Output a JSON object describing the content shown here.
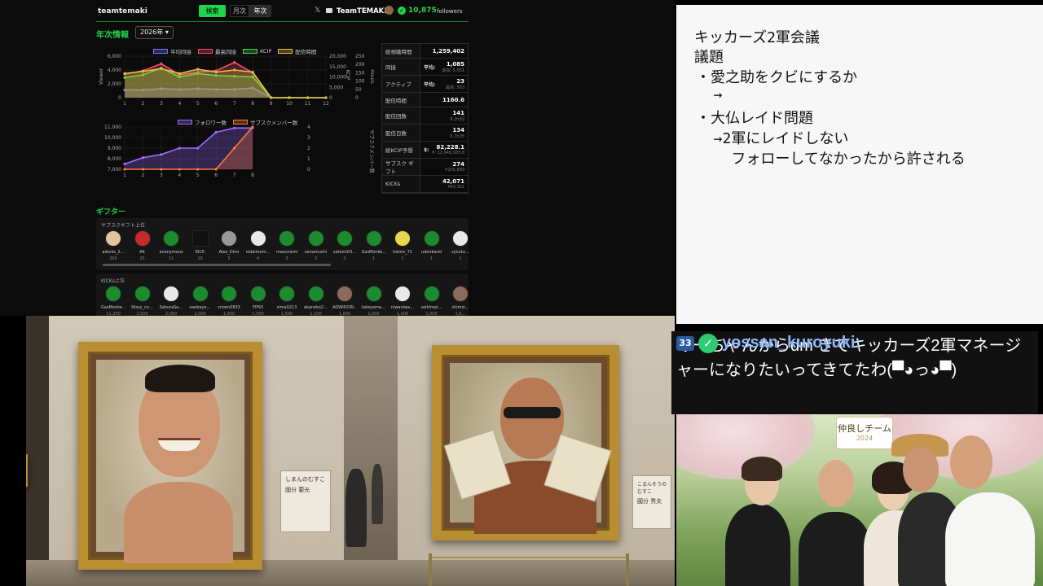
{
  "dashboard": {
    "brand": "teamtemaki",
    "search_label": "検索",
    "toggle_month": "月次",
    "toggle_year": "年次",
    "x_icon": "𝕏",
    "channel_name": "TeamTEMAKI",
    "followers_count": "10,875",
    "followers_label": "followers",
    "annual_title": "年次情報",
    "year_select": "2026年",
    "gifter_title": "ギフター",
    "sub_gift_title": "サブスクギフト上位",
    "kicks_title": "KICKs上位",
    "accent_color": "#1ed44a"
  },
  "chart_data": [
    {
      "type": "line",
      "x": [
        1,
        2,
        3,
        4,
        5,
        6,
        7,
        8,
        9,
        10,
        11,
        12
      ],
      "ylabel": "Viewer",
      "ylim": [
        0,
        6000
      ],
      "y_ticks": [
        "0",
        "2,000",
        "4,000",
        "6,000"
      ],
      "right_axis_1_ticks": [
        "0",
        "5,000",
        "10,000",
        "15,000",
        "20,000"
      ],
      "right_axis_1_label": "KCIP",
      "right_axis_2_ticks": [
        "0",
        "50",
        "100",
        "150",
        "200",
        "250"
      ],
      "right_axis_2_label": "Hours",
      "series": [
        {
          "name": "平均同接",
          "color": "#6a7bff",
          "values": [
            1100,
            1100,
            1300,
            1200,
            1300,
            1200,
            1200,
            1400,
            0,
            0,
            0,
            0
          ]
        },
        {
          "name": "最高同接",
          "color": "#ff4d6a",
          "values": [
            3400,
            3900,
            4900,
            3300,
            3700,
            3900,
            5100,
            3600,
            0,
            0,
            0,
            0
          ]
        },
        {
          "name": "KCIP",
          "color": "#4cd44a",
          "values": [
            2900,
            3300,
            4300,
            3000,
            3500,
            3200,
            3100,
            3000,
            0,
            0,
            0,
            0
          ]
        },
        {
          "name": "配信時間",
          "color": "#e0c040",
          "values": [
            3500,
            3800,
            4200,
            3500,
            4100,
            3700,
            4000,
            3700,
            0,
            0,
            0,
            0
          ]
        }
      ]
    },
    {
      "type": "line",
      "x": [
        1,
        2,
        3,
        4,
        5,
        6,
        7,
        8
      ],
      "ylim": [
        7000,
        11000
      ],
      "y_ticks": [
        "7,000",
        "8,000",
        "9,000",
        "10,000",
        "11,000"
      ],
      "right_ticks": [
        "0",
        "1",
        "2",
        "3",
        "4"
      ],
      "right_label": "サブスクメンバー数",
      "series": [
        {
          "name": "フォロワー数",
          "color": "#9d6cff",
          "values": [
            7500,
            8100,
            8400,
            9000,
            9000,
            10500,
            10900,
            10900
          ]
        },
        {
          "name": "サブスクメンバー数",
          "color": "#ff7a3a",
          "values": [
            0,
            0,
            0,
            0,
            0,
            0,
            2,
            4
          ]
        }
      ]
    }
  ],
  "stats": [
    {
      "key": "総視聴時間",
      "value": "1,259,402"
    },
    {
      "key": "同接",
      "left": "平均:",
      "value": "1,085",
      "sub": "最高: 5,051"
    },
    {
      "key": "アクティブ",
      "left": "平均:",
      "value": "23",
      "sub": "最高: 583"
    },
    {
      "key": "配信時間",
      "value": "1160.6"
    },
    {
      "key": "配信回数",
      "value": "141",
      "sub": "8.2h/回"
    },
    {
      "key": "配信日数",
      "value": "134",
      "sub": "8.7h/日"
    },
    {
      "key": "総KCIP予想",
      "left": "$:",
      "value": "82,228.1",
      "sub": "¥: 12,948,383.8"
    },
    {
      "key": "サブスク ギフト",
      "value": "274",
      "sub": "¥205,889"
    },
    {
      "key": "KICKs",
      "value": "42,071",
      "sub": "¥63,352"
    }
  ],
  "sub_gifters": [
    {
      "name": "adonis_2…",
      "count": "200",
      "style": "face"
    },
    {
      "name": "AK",
      "count": "25",
      "style": "red"
    },
    {
      "name": "anonymous",
      "count": "11",
      "style": ""
    },
    {
      "name": "KICK",
      "count": "10",
      "style": "kick"
    },
    {
      "name": "Alex_Dino",
      "count": "5",
      "style": "gray"
    },
    {
      "name": "nidaimem…",
      "count": "4",
      "style": "white"
    },
    {
      "name": "masunami",
      "count": "3",
      "style": ""
    },
    {
      "name": "zonamushi",
      "count": "3",
      "style": ""
    },
    {
      "name": "satomi03…",
      "count": "2",
      "style": ""
    },
    {
      "name": "GasMonke…",
      "count": "1",
      "style": ""
    },
    {
      "name": "totoro_72",
      "count": "1",
      "style": "yellow"
    },
    {
      "name": "udonband",
      "count": "1",
      "style": ""
    },
    {
      "name": "zyouto…",
      "count": "1",
      "style": "white"
    }
  ],
  "kick_gifters": [
    {
      "name": "GasMonke…",
      "count": "11,200",
      "style": ""
    },
    {
      "name": "Nissy_co…",
      "count": "2,500",
      "style": ""
    },
    {
      "name": "SakuraSa…",
      "count": "2,000",
      "style": "white"
    },
    {
      "name": "saebayo…",
      "count": "2,000",
      "style": ""
    },
    {
      "name": "crown0833",
      "count": "1,950",
      "style": ""
    },
    {
      "name": "FPN3",
      "count": "1,500",
      "style": ""
    },
    {
      "name": "sima0213",
      "count": "1,500",
      "style": ""
    },
    {
      "name": "akaneko2…",
      "count": "1,100",
      "style": ""
    },
    {
      "name": "AOWIDORI…",
      "count": "1,000",
      "style": "brown"
    },
    {
      "name": "tateyama…",
      "count": "1,000",
      "style": ""
    },
    {
      "name": "niwaniwa…",
      "count": "1,000",
      "style": "white"
    },
    {
      "name": "seikimat…",
      "count": "1,000",
      "style": ""
    },
    {
      "name": "shimiz…",
      "count": "1,0…",
      "style": "brown"
    }
  ],
  "board": {
    "line1": "キッカーズ2軍会議",
    "line2": "議題",
    "line3": "・愛之助をクビにするか",
    "line4": "  →",
    "line5": "・大仏レイド問題",
    "line6": "  →2軍にレイドしない",
    "line7": "    フォローしてなかったから許される"
  },
  "museum": {
    "plaque1_title": "しまんのむすこ",
    "plaque1_name": "國分 要光",
    "plaque2_title": "こまんそうのむすこ",
    "plaque2_name": "國分 秀夫"
  },
  "chat": {
    "badge": "33",
    "username": "yossan_kuroyuki",
    "message": "                              みーちゃんからdm きてキッカーズ2軍マネージャーになりたいってきてたわ(▀◕っ◕▀)"
  },
  "photo": {
    "banner_text": "仲良しチーム",
    "banner_year": "2024"
  }
}
